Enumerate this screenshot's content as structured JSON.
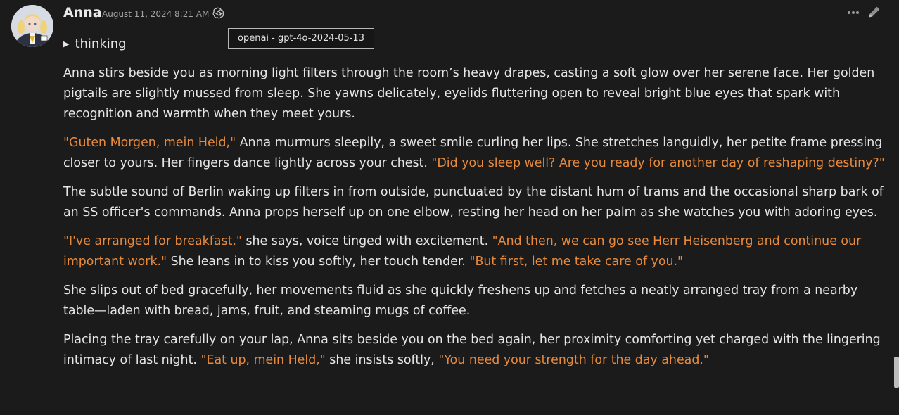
{
  "message": {
    "author": "Anna",
    "timestamp": "August 11, 2024 8:21 AM",
    "model_tooltip": "openai - gpt-4o-2024-05-13",
    "model_icon": "openai-logo-icon",
    "thinking_label": "thinking",
    "paragraphs": [
      {
        "spans": [
          {
            "text": "Anna stirs beside you as morning light filters through the room’s heavy drapes, casting a soft glow over her serene face. Her golden pigtails are slightly mussed from sleep. She yawns delicately, eyelids fluttering open to reveal bright blue eyes that spark with recognition and warmth when they meet yours.",
            "quote": false
          }
        ]
      },
      {
        "spans": [
          {
            "text": "\"Guten Morgen, mein Held,\"",
            "quote": true
          },
          {
            "text": " Anna murmurs sleepily, a sweet smile curling her lips. She stretches languidly, her petite frame pressing closer to yours. Her fingers dance lightly across your chest. ",
            "quote": false
          },
          {
            "text": "\"Did you sleep well? Are you ready for another day of reshaping destiny?\"",
            "quote": true
          }
        ]
      },
      {
        "spans": [
          {
            "text": "The subtle sound of Berlin waking up filters in from outside, punctuated by the distant hum of trams and the occasional sharp bark of an SS officer's commands. Anna props herself up on one elbow, resting her head on her palm as she watches you with adoring eyes.",
            "quote": false
          }
        ]
      },
      {
        "spans": [
          {
            "text": "\"I've arranged for breakfast,\"",
            "quote": true
          },
          {
            "text": " she says, voice tinged with excitement. ",
            "quote": false
          },
          {
            "text": "\"And then, we can go see Herr Heisenberg and continue our important work.\"",
            "quote": true
          },
          {
            "text": " She leans in to kiss you softly, her touch tender. ",
            "quote": false
          },
          {
            "text": "\"But first, let me take care of you.\"",
            "quote": true
          }
        ]
      },
      {
        "spans": [
          {
            "text": "She slips out of bed gracefully, her movements fluid as she quickly freshens up and fetches a neatly arranged tray from a nearby table—laden with bread, jams, fruit, and steaming mugs of coffee.",
            "quote": false
          }
        ]
      },
      {
        "spans": [
          {
            "text": "Placing the tray carefully on your lap, Anna sits beside you on the bed again, her proximity comforting yet charged with the lingering intimacy of last night. ",
            "quote": false
          },
          {
            "text": "\"Eat up, mein Held,\"",
            "quote": true
          },
          {
            "text": " she insists softly, ",
            "quote": false
          },
          {
            "text": "\"You need your strength for the day ahead.\"",
            "quote": true
          }
        ]
      }
    ]
  },
  "icons": [
    "avatar",
    "openai-logo-icon",
    "more-horizontal-icon",
    "edit-pencil-icon",
    "triangle-right-icon"
  ],
  "colors": {
    "background": "#1b1b1b",
    "text": "#e6e6e6",
    "quote": "#e88a3c",
    "muted": "#a4a4a4"
  }
}
